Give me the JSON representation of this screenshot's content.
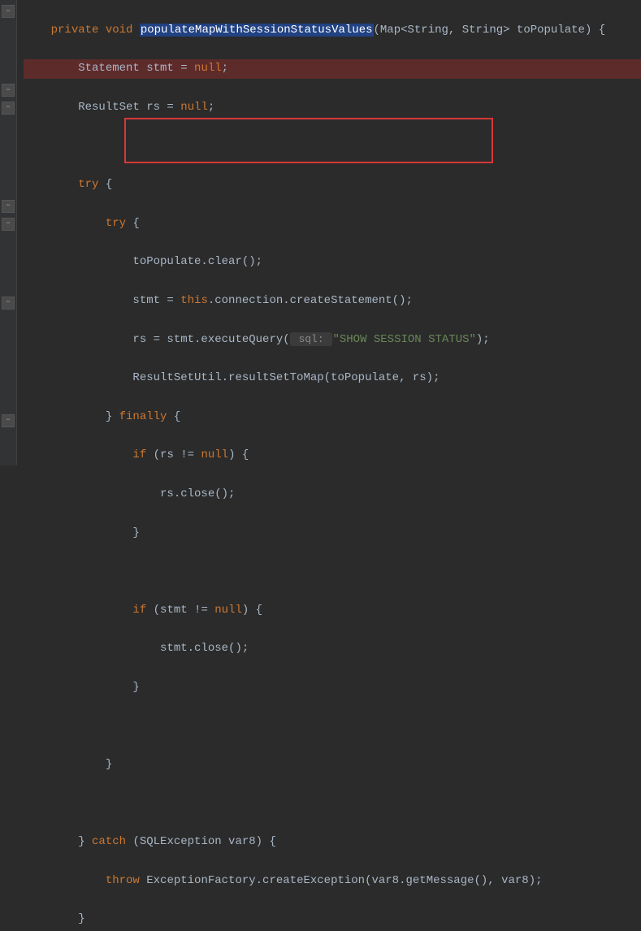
{
  "code": {
    "l1": {
      "kw1": "private ",
      "kw2": "void ",
      "method": "populateMapWithSessionStatusValues",
      "rest": "(Map<String, String> toPopulate) {"
    },
    "l2": "        Statement stmt = ",
    "l2_null": "null",
    "l2_end": ";",
    "l3": "        ResultSet rs = ",
    "l3_null": "null",
    "l3_end": ";",
    "l5_try": "        try ",
    "l5_brace": "{",
    "l6_try": "            try ",
    "l6_brace": "{",
    "l7": "                toPopulate.clear();",
    "l8a": "                stmt = ",
    "l8_this": "this",
    "l8b": ".connection.createStatement();",
    "l9a": "                rs = stmt.executeQuery(",
    "l9_hint": " sql: ",
    "l9_str": "\"SHOW SESSION STATUS\"",
    "l9b": ");",
    "l10": "                ResultSetUtil.resultSetToMap(toPopulate, rs);",
    "l11a": "            } ",
    "l11_finally": "finally ",
    "l11b": "{",
    "l12a": "                if ",
    "l12b": "(rs != ",
    "l12_null": "null",
    "l12c": ") {",
    "l13": "                    rs.close();",
    "l14": "                }",
    "l16a": "                if ",
    "l16b": "(stmt != ",
    "l16_null": "null",
    "l16c": ") {",
    "l17": "                    stmt.close();",
    "l18": "                }",
    "l20": "            }",
    "l22a": "        } ",
    "l22_catch": "catch ",
    "l22b": "(SQLException var8) {",
    "l23a": "            throw ",
    "l23b": "ExceptionFactory.createException(var8.getMessage(), var8);",
    "l24": "        }"
  }
}
